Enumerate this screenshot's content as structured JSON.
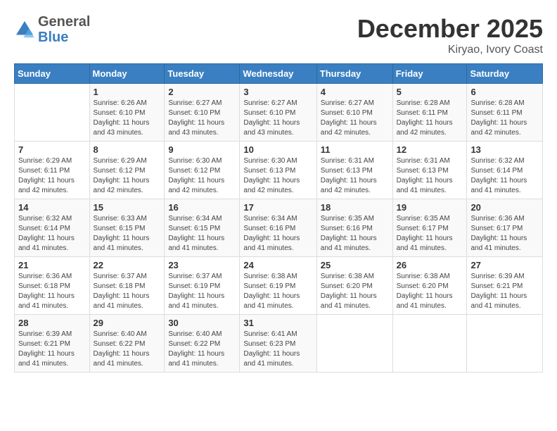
{
  "logo": {
    "line1": "General",
    "line2": "Blue"
  },
  "title": "December 2025",
  "location": "Kiryao, Ivory Coast",
  "days_of_week": [
    "Sunday",
    "Monday",
    "Tuesday",
    "Wednesday",
    "Thursday",
    "Friday",
    "Saturday"
  ],
  "weeks": [
    [
      {
        "day": "",
        "info": ""
      },
      {
        "day": "1",
        "info": "Sunrise: 6:26 AM\nSunset: 6:10 PM\nDaylight: 11 hours\nand 43 minutes."
      },
      {
        "day": "2",
        "info": "Sunrise: 6:27 AM\nSunset: 6:10 PM\nDaylight: 11 hours\nand 43 minutes."
      },
      {
        "day": "3",
        "info": "Sunrise: 6:27 AM\nSunset: 6:10 PM\nDaylight: 11 hours\nand 43 minutes."
      },
      {
        "day": "4",
        "info": "Sunrise: 6:27 AM\nSunset: 6:10 PM\nDaylight: 11 hours\nand 42 minutes."
      },
      {
        "day": "5",
        "info": "Sunrise: 6:28 AM\nSunset: 6:11 PM\nDaylight: 11 hours\nand 42 minutes."
      },
      {
        "day": "6",
        "info": "Sunrise: 6:28 AM\nSunset: 6:11 PM\nDaylight: 11 hours\nand 42 minutes."
      }
    ],
    [
      {
        "day": "7",
        "info": "Sunrise: 6:29 AM\nSunset: 6:11 PM\nDaylight: 11 hours\nand 42 minutes."
      },
      {
        "day": "8",
        "info": "Sunrise: 6:29 AM\nSunset: 6:12 PM\nDaylight: 11 hours\nand 42 minutes."
      },
      {
        "day": "9",
        "info": "Sunrise: 6:30 AM\nSunset: 6:12 PM\nDaylight: 11 hours\nand 42 minutes."
      },
      {
        "day": "10",
        "info": "Sunrise: 6:30 AM\nSunset: 6:13 PM\nDaylight: 11 hours\nand 42 minutes."
      },
      {
        "day": "11",
        "info": "Sunrise: 6:31 AM\nSunset: 6:13 PM\nDaylight: 11 hours\nand 42 minutes."
      },
      {
        "day": "12",
        "info": "Sunrise: 6:31 AM\nSunset: 6:13 PM\nDaylight: 11 hours\nand 41 minutes."
      },
      {
        "day": "13",
        "info": "Sunrise: 6:32 AM\nSunset: 6:14 PM\nDaylight: 11 hours\nand 41 minutes."
      }
    ],
    [
      {
        "day": "14",
        "info": "Sunrise: 6:32 AM\nSunset: 6:14 PM\nDaylight: 11 hours\nand 41 minutes."
      },
      {
        "day": "15",
        "info": "Sunrise: 6:33 AM\nSunset: 6:15 PM\nDaylight: 11 hours\nand 41 minutes."
      },
      {
        "day": "16",
        "info": "Sunrise: 6:34 AM\nSunset: 6:15 PM\nDaylight: 11 hours\nand 41 minutes."
      },
      {
        "day": "17",
        "info": "Sunrise: 6:34 AM\nSunset: 6:16 PM\nDaylight: 11 hours\nand 41 minutes."
      },
      {
        "day": "18",
        "info": "Sunrise: 6:35 AM\nSunset: 6:16 PM\nDaylight: 11 hours\nand 41 minutes."
      },
      {
        "day": "19",
        "info": "Sunrise: 6:35 AM\nSunset: 6:17 PM\nDaylight: 11 hours\nand 41 minutes."
      },
      {
        "day": "20",
        "info": "Sunrise: 6:36 AM\nSunset: 6:17 PM\nDaylight: 11 hours\nand 41 minutes."
      }
    ],
    [
      {
        "day": "21",
        "info": "Sunrise: 6:36 AM\nSunset: 6:18 PM\nDaylight: 11 hours\nand 41 minutes."
      },
      {
        "day": "22",
        "info": "Sunrise: 6:37 AM\nSunset: 6:18 PM\nDaylight: 11 hours\nand 41 minutes."
      },
      {
        "day": "23",
        "info": "Sunrise: 6:37 AM\nSunset: 6:19 PM\nDaylight: 11 hours\nand 41 minutes."
      },
      {
        "day": "24",
        "info": "Sunrise: 6:38 AM\nSunset: 6:19 PM\nDaylight: 11 hours\nand 41 minutes."
      },
      {
        "day": "25",
        "info": "Sunrise: 6:38 AM\nSunset: 6:20 PM\nDaylight: 11 hours\nand 41 minutes."
      },
      {
        "day": "26",
        "info": "Sunrise: 6:38 AM\nSunset: 6:20 PM\nDaylight: 11 hours\nand 41 minutes."
      },
      {
        "day": "27",
        "info": "Sunrise: 6:39 AM\nSunset: 6:21 PM\nDaylight: 11 hours\nand 41 minutes."
      }
    ],
    [
      {
        "day": "28",
        "info": "Sunrise: 6:39 AM\nSunset: 6:21 PM\nDaylight: 11 hours\nand 41 minutes."
      },
      {
        "day": "29",
        "info": "Sunrise: 6:40 AM\nSunset: 6:22 PM\nDaylight: 11 hours\nand 41 minutes."
      },
      {
        "day": "30",
        "info": "Sunrise: 6:40 AM\nSunset: 6:22 PM\nDaylight: 11 hours\nand 41 minutes."
      },
      {
        "day": "31",
        "info": "Sunrise: 6:41 AM\nSunset: 6:23 PM\nDaylight: 11 hours\nand 41 minutes."
      },
      {
        "day": "",
        "info": ""
      },
      {
        "day": "",
        "info": ""
      },
      {
        "day": "",
        "info": ""
      }
    ]
  ]
}
